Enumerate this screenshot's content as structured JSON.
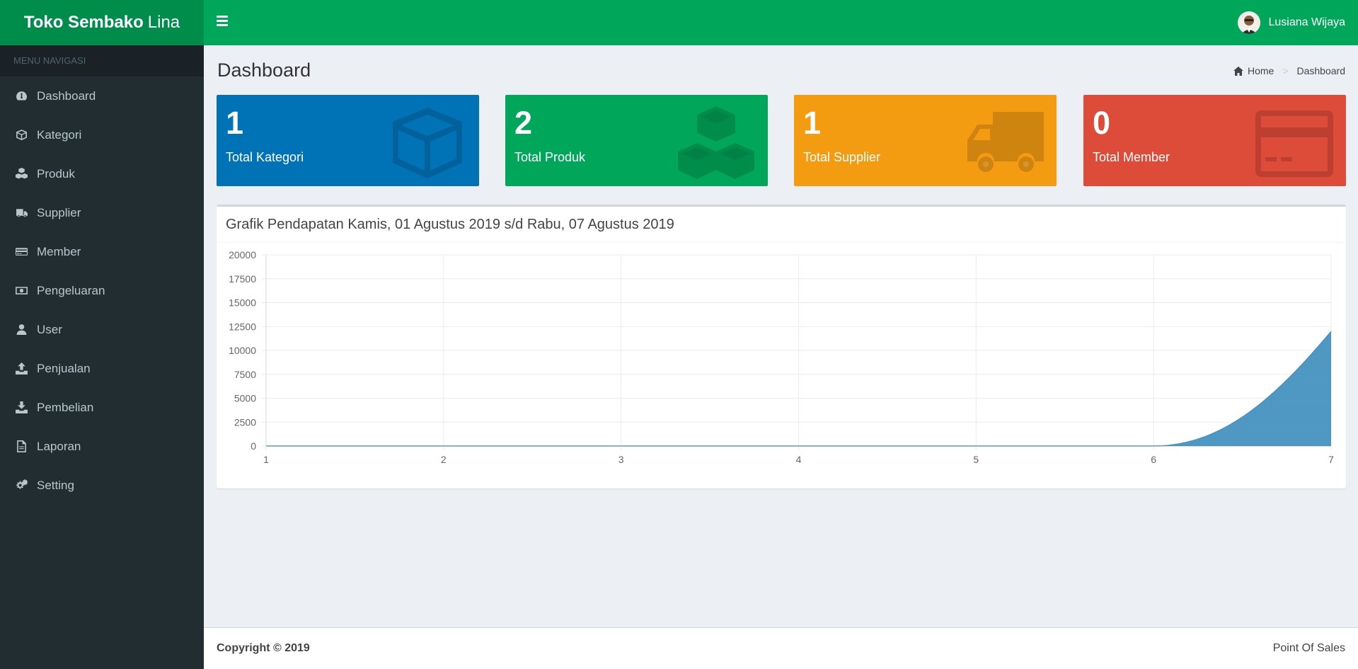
{
  "brand": {
    "bold": "Toko Sembako",
    "light": "Lina"
  },
  "user": {
    "name": "Lusiana Wijaya"
  },
  "sidebar": {
    "header": "MENU NAVIGASI",
    "items": [
      {
        "label": "Dashboard",
        "icon": "dashboard-icon"
      },
      {
        "label": "Kategori",
        "icon": "cube-icon"
      },
      {
        "label": "Produk",
        "icon": "cubes-icon"
      },
      {
        "label": "Supplier",
        "icon": "truck-icon"
      },
      {
        "label": "Member",
        "icon": "credit-card-icon"
      },
      {
        "label": "Pengeluaran",
        "icon": "money-icon"
      },
      {
        "label": "User",
        "icon": "user-icon"
      },
      {
        "label": "Penjualan",
        "icon": "upload-icon"
      },
      {
        "label": "Pembelian",
        "icon": "download-icon"
      },
      {
        "label": "Laporan",
        "icon": "file-pdf-icon"
      },
      {
        "label": "Setting",
        "icon": "gears-icon"
      }
    ]
  },
  "page": {
    "title": "Dashboard",
    "breadcrumb": {
      "home": "Home",
      "current": "Dashboard"
    }
  },
  "stats": [
    {
      "value": "1",
      "label": "Total Kategori",
      "color": "#0073b7",
      "icon": "cube-icon"
    },
    {
      "value": "2",
      "label": "Total Produk",
      "color": "#00a65a",
      "icon": "cubes-icon"
    },
    {
      "value": "1",
      "label": "Total Supplier",
      "color": "#f39c12",
      "icon": "truck-icon"
    },
    {
      "value": "0",
      "label": "Total Member",
      "color": "#dd4b39",
      "icon": "credit-card-icon"
    }
  ],
  "chart_box": {
    "title": "Grafik Pendapatan Kamis, 01 Agustus 2019 s/d Rabu, 07 Agustus 2019"
  },
  "chart_data": {
    "type": "area",
    "x": [
      1,
      2,
      3,
      4,
      5,
      6,
      7
    ],
    "series": [
      {
        "values": [
          0,
          0,
          0,
          0,
          0,
          0,
          12000
        ],
        "color": "#3c8dbc"
      }
    ],
    "ylim": [
      0,
      20000
    ],
    "yticks": [
      0,
      2500,
      5000,
      7500,
      10000,
      12500,
      15000,
      17500,
      20000
    ],
    "grid": true
  },
  "footer": {
    "copyright": "Copyright © 2019",
    "app_name": "Point Of Sales"
  }
}
